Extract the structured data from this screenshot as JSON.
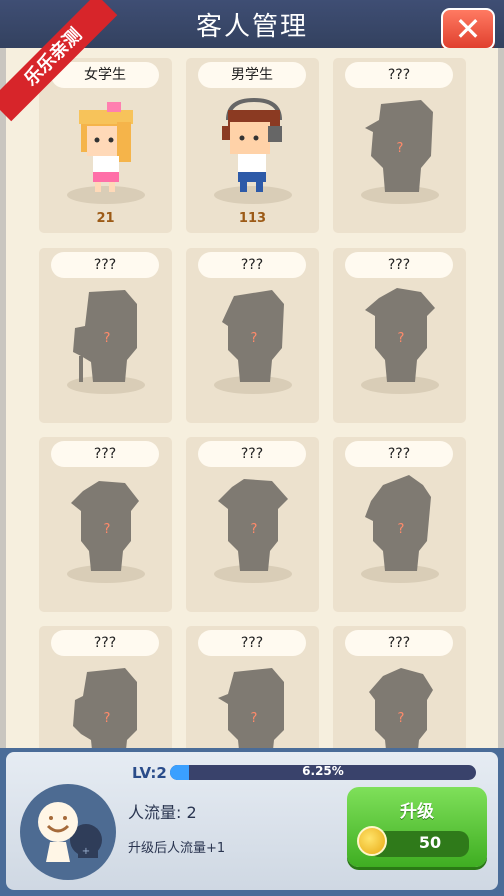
{
  "header": {
    "title": "客人管理",
    "close_label": "✕",
    "ribbon_label": "乐乐亲测"
  },
  "cards": [
    {
      "name": "女学生",
      "count": "21"
    },
    {
      "name": "男学生",
      "count": "113"
    },
    {
      "name": "???"
    },
    {
      "name": "???"
    },
    {
      "name": "???"
    },
    {
      "name": "???"
    },
    {
      "name": "???"
    },
    {
      "name": "???"
    },
    {
      "name": "???"
    },
    {
      "name": "???"
    },
    {
      "name": "???"
    },
    {
      "name": "???"
    }
  ],
  "silhouette_mark": "?",
  "footer": {
    "level_label": "LV:2",
    "progress_text": "6.25%",
    "progress_value": 0.0625,
    "flow_label": "人流量: 2",
    "hint": "升级后人流量+1",
    "upgrade_label": "升级",
    "upgrade_price": "50"
  },
  "colors": {
    "header_bg": "#3f4e74",
    "card_bg": "#ece1cd",
    "silhouette": "#7f7a72",
    "upgrade_green": "#5ecb3a",
    "close_red": "#e8503a"
  }
}
